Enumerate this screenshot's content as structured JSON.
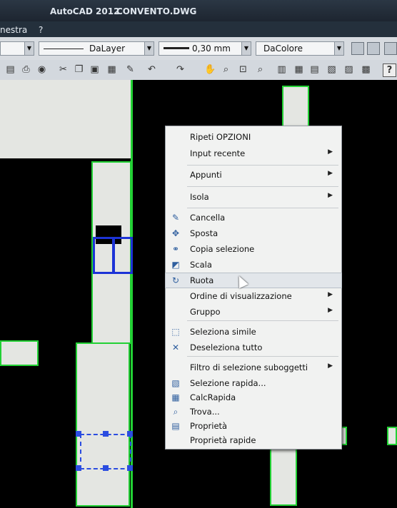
{
  "window": {
    "app_title": "AutoCAD 2012",
    "document": "CONVENTO.DWG"
  },
  "menubar": {
    "items": [
      "nestra",
      "?"
    ]
  },
  "properties": {
    "linetype": "DaLayer",
    "lineweight": "0,30 mm",
    "plotstyle": "DaColore"
  },
  "context_menu": {
    "items": [
      {
        "label": "Ripeti OPZIONI",
        "submenu": false,
        "icon": null
      },
      {
        "label": "Input recente",
        "submenu": true,
        "icon": null
      },
      {
        "label": "Appunti",
        "submenu": true,
        "icon": null
      },
      {
        "label": "Isola",
        "submenu": true,
        "icon": null
      },
      {
        "label": "Cancella",
        "submenu": false,
        "icon": "erase-icon"
      },
      {
        "label": "Sposta",
        "submenu": false,
        "icon": "move-icon"
      },
      {
        "label": "Copia selezione",
        "submenu": false,
        "icon": "copy-icon"
      },
      {
        "label": "Scala",
        "submenu": false,
        "icon": "scale-icon"
      },
      {
        "label": "Ruota",
        "submenu": false,
        "icon": "rotate-icon",
        "highlighted": true
      },
      {
        "label": "Ordine di visualizzazione",
        "submenu": true,
        "icon": null
      },
      {
        "label": "Gruppo",
        "submenu": true,
        "icon": null
      },
      {
        "label": "Seleziona simile",
        "submenu": false,
        "icon": "select-similar-icon"
      },
      {
        "label": "Deseleziona tutto",
        "submenu": false,
        "icon": "deselect-icon"
      },
      {
        "label": "Filtro di selezione suboggetti",
        "submenu": true,
        "icon": null
      },
      {
        "label": "Selezione rapida...",
        "submenu": false,
        "icon": "quick-select-icon"
      },
      {
        "label": "CalcRapida",
        "submenu": false,
        "icon": "calculator-icon"
      },
      {
        "label": "Trova...",
        "submenu": false,
        "icon": "find-icon"
      },
      {
        "label": "Proprietà",
        "submenu": false,
        "icon": "properties-icon"
      },
      {
        "label": "Proprietà rapide",
        "submenu": false,
        "icon": null
      }
    ]
  },
  "colors": {
    "wall_outline": "#22d134",
    "selection": "#1c33d6",
    "background": "#000000"
  }
}
